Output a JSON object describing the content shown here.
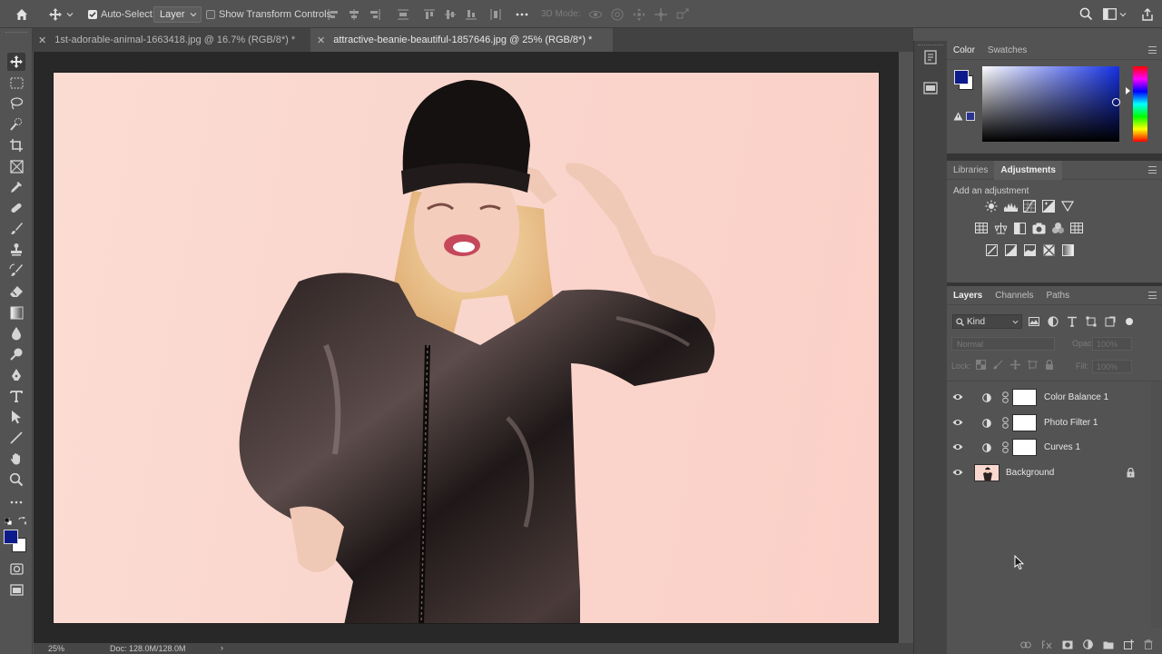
{
  "options_bar": {
    "auto_select_label": "Auto-Select:",
    "auto_select_value": "Layer",
    "show_transform_label": "Show Transform Controls",
    "mode_3d_label": "3D Mode:"
  },
  "tabs": [
    {
      "label": "1st-adorable-animal-1663418.jpg @ 16.7% (RGB/8*) *",
      "active": false
    },
    {
      "label": "attractive-beanie-beautiful-1857646.jpg @ 25% (RGB/8*) *",
      "active": true
    }
  ],
  "status": {
    "zoom": "25%",
    "doc": "Doc: 128.0M/128.0M"
  },
  "color_panel": {
    "tabs": [
      "Color",
      "Swatches"
    ],
    "foreground": "#0d1a8c",
    "background": "#ffffff",
    "hue_color": "#1430e6"
  },
  "adjustments_panel": {
    "tabs": [
      "Libraries",
      "Adjustments"
    ],
    "active_tab": "Adjustments",
    "hint": "Add an adjustment"
  },
  "layers_panel": {
    "tabs": [
      "Layers",
      "Channels",
      "Paths"
    ],
    "filter_kind": "Kind",
    "blend_mode": "Normal",
    "opacity_label": "Opacity:",
    "opacity_value": "100%",
    "lock_label": "Lock:",
    "fill_label": "Fill:",
    "fill_value": "100%",
    "layers": [
      {
        "name": "Color Balance 1",
        "type": "adjustment"
      },
      {
        "name": "Photo Filter 1",
        "type": "adjustment"
      },
      {
        "name": "Curves 1",
        "type": "adjustment"
      },
      {
        "name": "Background",
        "type": "image",
        "locked": true
      }
    ]
  }
}
